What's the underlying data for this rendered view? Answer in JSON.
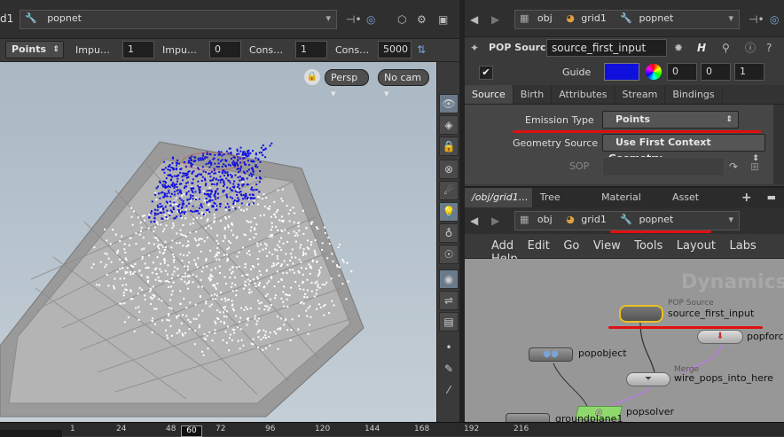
{
  "left_path": {
    "prefix": "d1",
    "node": "popnet"
  },
  "toolbar": {
    "mode": "Points",
    "fields": [
      {
        "label": "Impu…",
        "value": "1"
      },
      {
        "label": "Impu…",
        "value": "0"
      },
      {
        "label": "Cons…",
        "value": "1"
      },
      {
        "label": "Cons…",
        "value": "5000"
      }
    ]
  },
  "viewport": {
    "persp": "Persp",
    "cam": "No cam"
  },
  "ruler": {
    "frame": "60",
    "ticks": [
      "1",
      "24",
      "48",
      "72",
      "96",
      "120",
      "144",
      "168",
      "192",
      "216"
    ]
  },
  "right_path": {
    "obj": "obj",
    "grid": "grid1",
    "node": "popnet"
  },
  "param": {
    "type": "POP Source",
    "name": "source_first_input",
    "guide_label": "Guide",
    "guide_values": [
      "0",
      "0",
      "1"
    ],
    "tabs": [
      "Source",
      "Birth",
      "Attributes",
      "Stream",
      "Bindings"
    ],
    "emission_label": "Emission Type",
    "emission_value": "Points",
    "geo_label": "Geometry Source",
    "geo_value": "Use First Context Geometry",
    "sop_label": "SOP",
    "guide_color": "#1010dd"
  },
  "network_tabs": [
    "/obj/grid1…",
    "Tree View",
    "Material P…",
    "Asset Bro…"
  ],
  "network_path": {
    "obj": "obj",
    "grid": "grid1",
    "node": "popnet"
  },
  "menu": [
    "Add",
    "Edit",
    "Go",
    "View",
    "Tools",
    "Layout",
    "Labs",
    "Help"
  ],
  "network": {
    "watermark": "Dynamics",
    "nodes": {
      "source_type": "POP Source",
      "source": "source_first_input",
      "popforce": "popforce",
      "popobject": "popobject",
      "merge_type": "Merge",
      "merge": "wire_pops_into_here",
      "popsolver": "popsolver",
      "groundplane": "groundplane1"
    }
  },
  "colors": {
    "accent_red": "#e01010",
    "solver_green": "#8fd86e",
    "merge_violet": "#b77fe0",
    "selected_yellow": "#e8c020"
  }
}
